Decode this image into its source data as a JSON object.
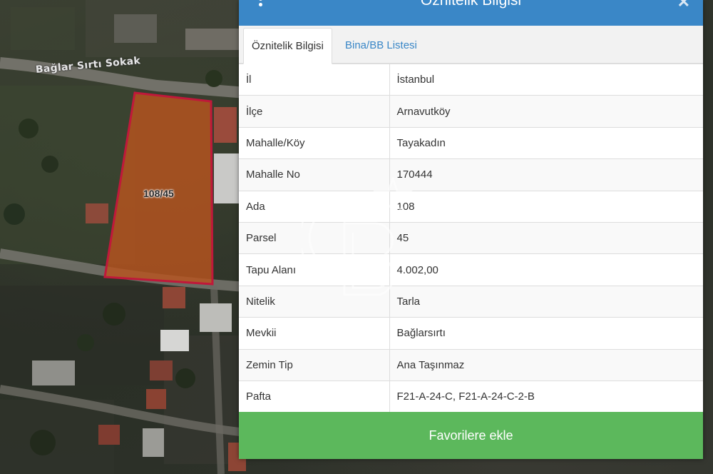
{
  "map": {
    "street_label": "Bağlar Sırtı Sokak",
    "parcel_label": "108/45",
    "parcel_fill": "#b8541f",
    "parcel_stroke": "#c0183a"
  },
  "panel": {
    "title": "Öznitelik Bilgisi",
    "header_color": "#3a87c7",
    "tabs": [
      {
        "label": "Öznitelik Bilgisi",
        "active": true
      },
      {
        "label": "Bina/BB Listesi",
        "active": false
      }
    ],
    "rows": [
      {
        "key": "İl",
        "value": "İstanbul"
      },
      {
        "key": "İlçe",
        "value": "Arnavutköy"
      },
      {
        "key": "Mahalle/Köy",
        "value": "Tayakadın"
      },
      {
        "key": "Mahalle No",
        "value": "170444"
      },
      {
        "key": "Ada",
        "value": "108"
      },
      {
        "key": "Parsel",
        "value": "45"
      },
      {
        "key": "Tapu Alanı",
        "value": "4.002,00"
      },
      {
        "key": "Nitelik",
        "value": "Tarla"
      },
      {
        "key": "Mevkii",
        "value": "Bağlarsırtı"
      },
      {
        "key": "Zemin Tip",
        "value": "Ana Taşınmaz"
      },
      {
        "key": "Pafta",
        "value": "F21-A-24-C, F21-A-24-C-2-B"
      }
    ],
    "favorite_button": "Favorilere ekle",
    "favorite_color": "#5cb85c"
  },
  "icons": {
    "menu": "kebab-menu-icon",
    "close": "close-icon",
    "watermark": "logo-watermark"
  }
}
